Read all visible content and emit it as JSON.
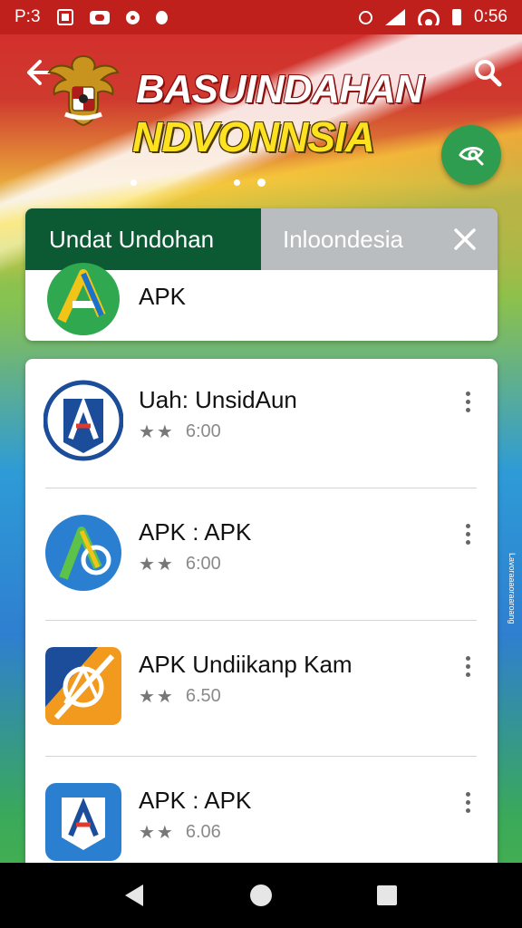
{
  "status_bar": {
    "left_text": "P:3",
    "time": "0:56"
  },
  "header": {
    "back_icon": "arrow-left-icon",
    "search_icon": "search-icon",
    "title_line1": "BASUINDAHAN",
    "title_line2": "NDVONNSIA",
    "fab_icon": "share-search-icon",
    "carousel_dots": 3
  },
  "tabs": {
    "active_label": "Undat Undohan",
    "inactive_label": "Inloondesia",
    "close_icon": "close-icon"
  },
  "pinned_app": {
    "label": "APK"
  },
  "apps": [
    {
      "title": "Uah: UnsidAun",
      "stars": "★★",
      "value": "6:00",
      "icon_color": "#1b4d9a"
    },
    {
      "title": "APK : APK",
      "stars": "★★",
      "value": "6:00",
      "icon_color": "#2a7fd0"
    },
    {
      "title": "APK Undiikanp Kam",
      "stars": "★★",
      "value": "6.50",
      "icon_color": "#f29a1e"
    },
    {
      "title": "APK : APK",
      "stars": "★★",
      "value": "6.06",
      "icon_color": "#2a7fd0"
    }
  ],
  "side_caption": "Lavoraaaoraaroang",
  "colors": {
    "status_bar": "#c0201c",
    "tab_active": "#0b5a34",
    "tab_inactive": "#b9bdbf",
    "fab": "#2e9d4f"
  }
}
